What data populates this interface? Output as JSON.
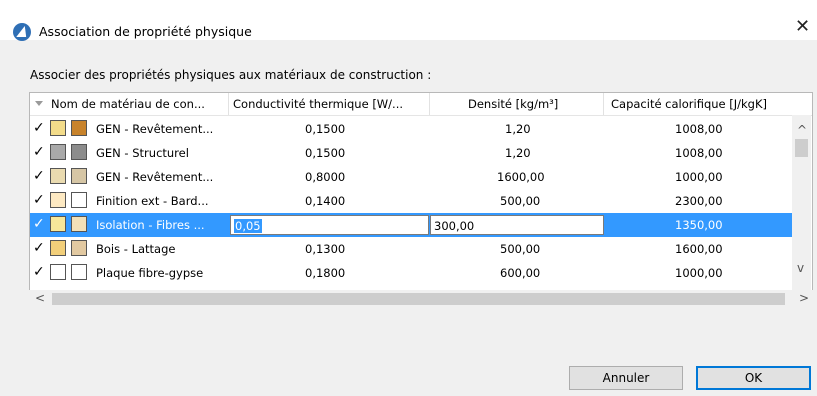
{
  "window": {
    "title": "Association de propriété physique",
    "close_glyph": "✕"
  },
  "prompt": "Associer des propriétés physiques aux matériaux de construction :",
  "columns": [
    "Nom de matériau de con...",
    "Conductivité thermique [W/...",
    "Densité [kg/m³]",
    "Capacité calorifique [J/kgK]"
  ],
  "rows": [
    {
      "name": "GEN - Revêtement...",
      "conductivity": "0,1500",
      "density": "1,20",
      "capacity": "1008,00",
      "swatch_pattern": "#f3dc8a",
      "swatch_color": "#c8832b"
    },
    {
      "name": "GEN - Structurel",
      "conductivity": "0,1500",
      "density": "1,20",
      "capacity": "1008,00",
      "swatch_pattern": "#a9a9a9",
      "swatch_color": "#8c8c8c"
    },
    {
      "name": "GEN - Revêtement...",
      "conductivity": "0,8000",
      "density": "1600,00",
      "capacity": "1000,00",
      "swatch_pattern": "#eadbb0",
      "swatch_color": "#d6c6a5"
    },
    {
      "name": "Finition ext - Bard...",
      "conductivity": "0,1400",
      "density": "500,00",
      "capacity": "2300,00",
      "swatch_pattern": "#fde9c2",
      "swatch_color": "#ffffff"
    },
    {
      "name": "Isolation - Fibres ...",
      "conductivity": "0,05",
      "density": "300,00",
      "capacity": "1350,00",
      "swatch_pattern": "#f7e79a",
      "swatch_color": "#f2e0b8"
    },
    {
      "name": "Bois - Lattage",
      "conductivity": "0,1300",
      "density": "500,00",
      "capacity": "1600,00",
      "swatch_pattern": "#f2cf7a",
      "swatch_color": "#e2c9a1"
    },
    {
      "name": "Plaque fibre-gypse",
      "conductivity": "0,1800",
      "density": "600,00",
      "capacity": "1000,00",
      "swatch_pattern": "#ffffff",
      "swatch_color": "#ffffff"
    }
  ],
  "scroll": {
    "up": "^",
    "down": "v",
    "left": "<",
    "right": ">"
  },
  "buttons": {
    "cancel": "Annuler",
    "ok": "OK"
  },
  "colors": {
    "selection": "#3399ff",
    "app_icon": "#2f6fb5",
    "default_button_border": "#0078d7"
  }
}
